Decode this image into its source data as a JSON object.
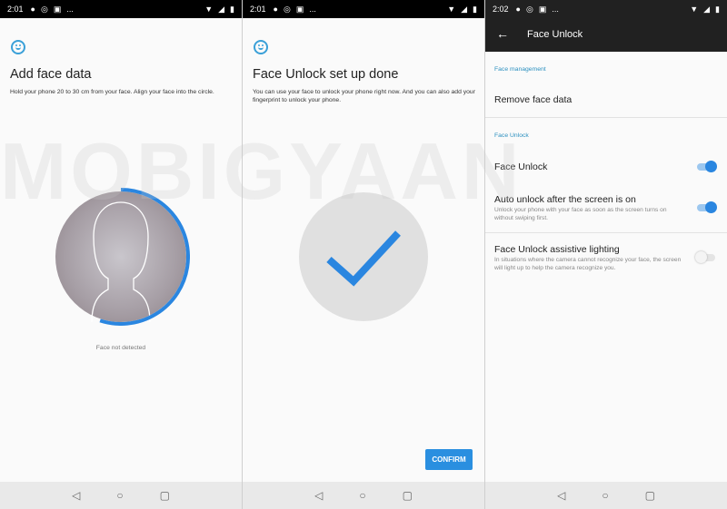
{
  "watermark": "MOBIGYAAN",
  "panels": [
    {
      "status": {
        "time": "2:01",
        "more": "..."
      },
      "title": "Add face data",
      "subtitle": "Hold your phone 20 to 30 cm from your face. Align your face into the circle.",
      "hint": "Face not detected",
      "progress_percent": 55
    },
    {
      "status": {
        "time": "2:01",
        "more": "..."
      },
      "title": "Face Unlock set up done",
      "subtitle": "You can use your face to unlock your phone right now. And you can also add your fingerprint to unlock your phone.",
      "confirm_label": "CONFIRM"
    },
    {
      "status": {
        "time": "2:02",
        "more": "..."
      },
      "toolbar_title": "Face Unlock",
      "section_management": "Face management",
      "remove_face_data": "Remove face data",
      "section_face_unlock": "Face Unlock",
      "settings": [
        {
          "title": "Face Unlock",
          "desc": "",
          "enabled": true
        },
        {
          "title": "Auto unlock after the screen is on",
          "desc": "Unlock your phone with your face as soon as the screen turns on without swiping first.",
          "enabled": true
        },
        {
          "title": "Face Unlock assistive lighting",
          "desc": "In situations where the camera cannot recognize your face, the screen will light up to help the camera recognize you.",
          "enabled": false
        }
      ]
    }
  ],
  "nav": {
    "back": "◁",
    "home": "○",
    "recents": "▢"
  },
  "colors": {
    "accent": "#2a8fe0",
    "status_bar": "#000000",
    "toolbar": "#212121"
  }
}
